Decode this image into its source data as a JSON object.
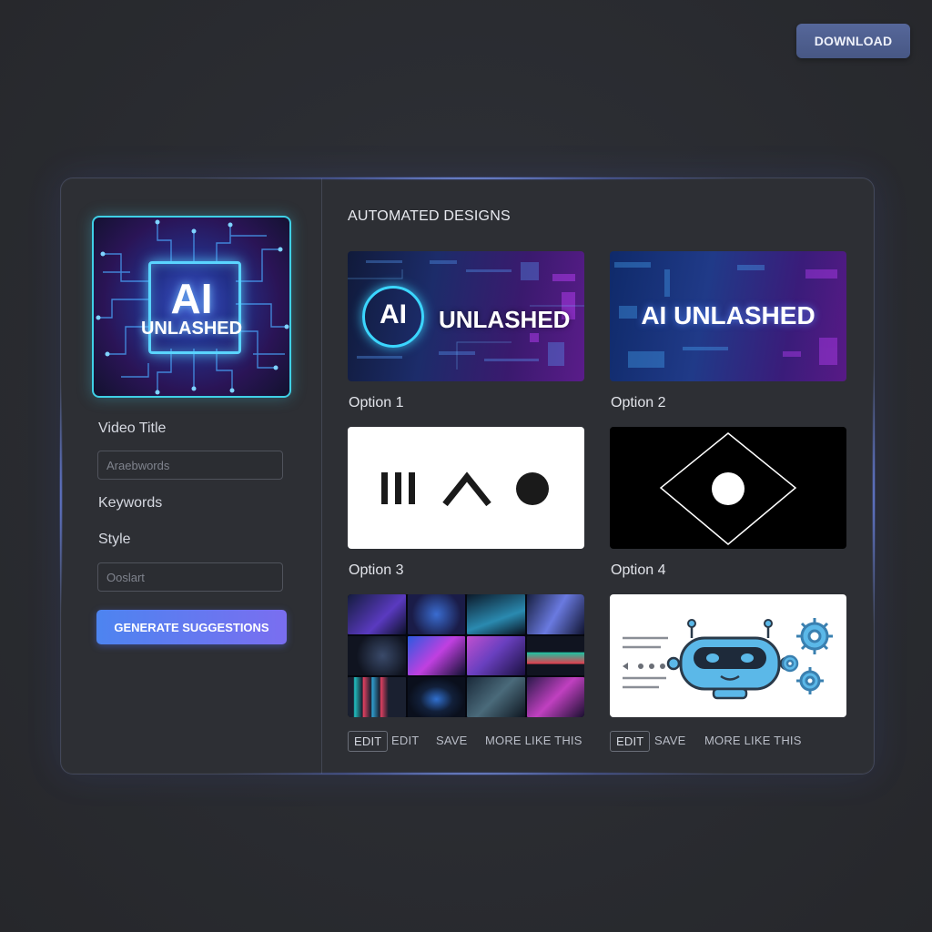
{
  "toolbar": {
    "download_label": "DOWNLOAD"
  },
  "sidebar": {
    "thumbnail": {
      "line1": "AI",
      "line2": "UNLASHED"
    },
    "video_title_label": "Video Title",
    "video_title_placeholder": "Araebwords",
    "keywords_label": "Keywords",
    "style_label": "Style",
    "style_placeholder": "Ooslart",
    "generate_label": "GENERATE SUGGESTIONS"
  },
  "designs": {
    "title": "AUTOMATED DESIGNS",
    "options": [
      {
        "label": "Option 1",
        "text_a": "AI",
        "text_b": "UNLASHED"
      },
      {
        "label": "Option 2",
        "text": "AI UNLASHED"
      },
      {
        "label": "Option 3"
      },
      {
        "label": "Option 4"
      }
    ],
    "row3_left_actions": [
      "EDIT",
      "EDIT",
      "SAVE",
      "MORE LIKE THIS"
    ],
    "row3_right_actions": [
      "EDIT",
      "SAVE",
      "MORE LIKE THIS"
    ]
  },
  "colors": {
    "accent_blue": "#4d84f0",
    "accent_purple": "#7a6ef0",
    "thumb_border": "#3fd0e6",
    "download_bg": "#4f5f90",
    "robot_blue": "#5bb8e8"
  },
  "icons": [
    "bars-icon",
    "caret-up-icon",
    "circle-icon",
    "diamond-icon",
    "robot-icon",
    "gear-icon"
  ]
}
